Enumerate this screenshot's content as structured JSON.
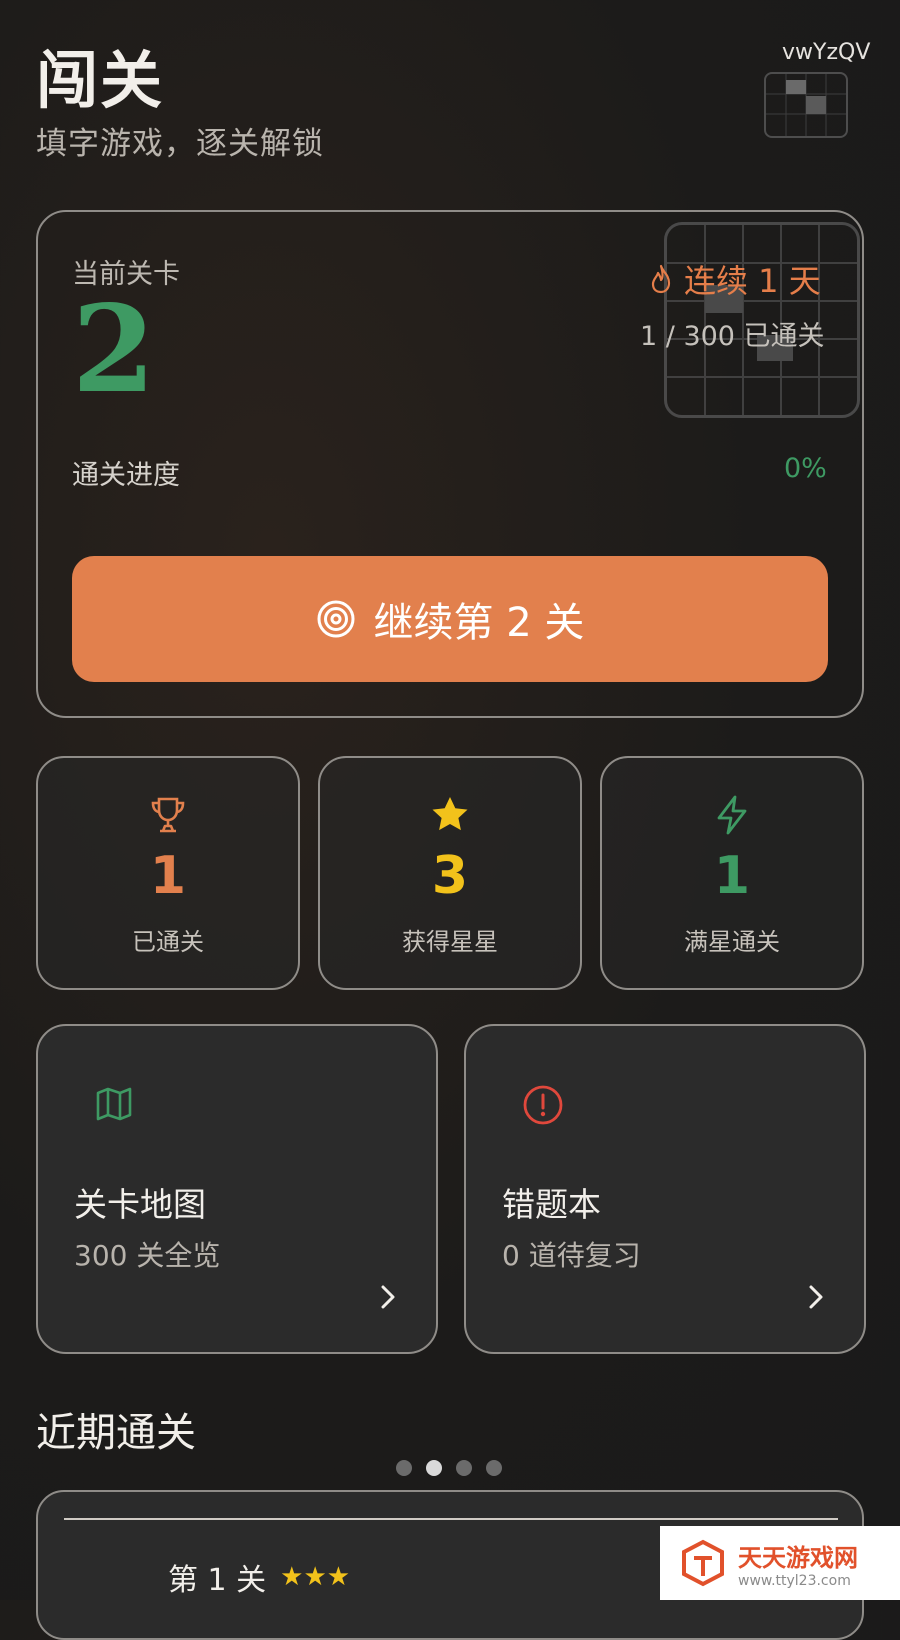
{
  "header": {
    "title": "闯关",
    "subtitle": "填字游戏，逐关解锁",
    "user_id": "vwYzQV"
  },
  "current": {
    "label": "当前关卡",
    "level": "2",
    "streak_text": "连续 1 天",
    "passed_total": "1 / 300 已通关",
    "progress_label": "通关进度",
    "progress_pct": "0%",
    "progress_value": 0,
    "continue_label": "继续第 2 关"
  },
  "stats": [
    {
      "value": "1",
      "label": "已通关",
      "color": "#e2804d",
      "icon": "trophy-icon"
    },
    {
      "value": "3",
      "label": "获得星星",
      "color": "#f2c21b",
      "icon": "star-icon"
    },
    {
      "value": "1",
      "label": "满星通关",
      "color": "#3e9a63",
      "icon": "lightning-icon"
    }
  ],
  "features": [
    {
      "title": "关卡地图",
      "subtitle": "300 关全览",
      "icon": "map-icon",
      "color": "#3e9a63"
    },
    {
      "title": "错题本",
      "subtitle": "0 道待复习",
      "icon": "alert-icon",
      "color": "#e0483c"
    }
  ],
  "recent": {
    "title": "近期通关",
    "pager_count": 4,
    "pager_active": 1,
    "items": [
      {
        "label": "第 1 关",
        "stars": "★★★"
      }
    ]
  },
  "watermark": {
    "name": "天天游戏网",
    "url": "www.ttyl23.com"
  },
  "colors": {
    "accent": "#e2804d",
    "green": "#3e9a63",
    "gold": "#f2c21b",
    "red": "#e0483c"
  }
}
